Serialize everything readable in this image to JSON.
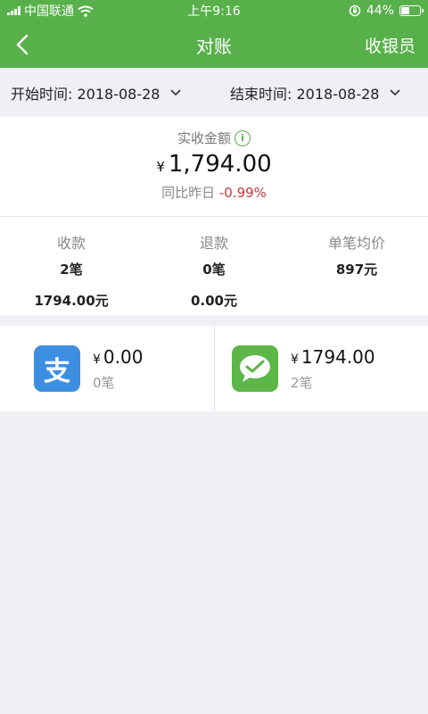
{
  "status_bar": {
    "carrier": "中国联通",
    "time": "上午9:16",
    "battery": "44%",
    "battery_level": 0.44
  },
  "nav": {
    "title": "对账",
    "right_action": "收银员",
    "back_icon": "chevron-left-icon"
  },
  "date_filter": {
    "start": "开始时间: 2018-08-28",
    "end": "结束时间: 2018-08-28"
  },
  "summary": {
    "label": "实收金额",
    "info_icon_text": "i",
    "currency": "¥",
    "amount": "1,794.00",
    "compare_label": "同比昨日",
    "compare_value": "-0.99%"
  },
  "stats": [
    {
      "label": "收款",
      "count": "2笔",
      "amount": "1794.00元"
    },
    {
      "label": "退款",
      "count": "0笔",
      "amount": "0.00元"
    },
    {
      "label": "单笔均价",
      "count": "897元",
      "amount": ""
    }
  ],
  "payments": {
    "alipay": {
      "currency": "¥",
      "amount": "0.00",
      "count": "0笔",
      "icon": "alipay-icon",
      "icon_text": "支",
      "color": "#3c8fe0"
    },
    "wechat": {
      "currency": "¥",
      "amount": "1794.00",
      "count": "2笔",
      "icon": "wechat-pay-icon",
      "color": "#5cb648"
    }
  },
  "colors": {
    "header": "#58b04a",
    "negative": "#d0343a",
    "background": "#efeff4"
  }
}
